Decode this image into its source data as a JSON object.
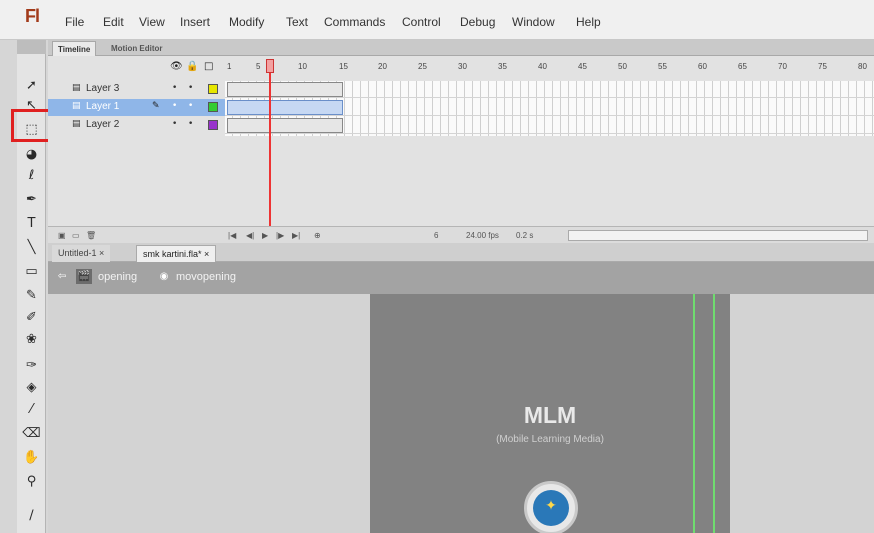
{
  "app": {
    "logo": "Fl"
  },
  "menu": [
    "File",
    "Edit",
    "View",
    "Insert",
    "Modify",
    "Text",
    "Commands",
    "Control",
    "Debug",
    "Window",
    "Help"
  ],
  "panel_tabs": {
    "timeline": "Timeline",
    "motion_editor": "Motion Editor"
  },
  "timeline": {
    "frame_numbers": [
      "1",
      "5",
      "10",
      "15",
      "20",
      "25",
      "30",
      "35",
      "40",
      "45",
      "50",
      "55",
      "60",
      "65",
      "70",
      "75",
      "80"
    ],
    "layers": [
      {
        "name": "Layer 3",
        "color": "#e6e600",
        "selected": false
      },
      {
        "name": "Layer 1",
        "color": "#33cc33",
        "selected": true
      },
      {
        "name": "Layer 2",
        "color": "#9933cc",
        "selected": false
      }
    ],
    "footer": {
      "frame": "6",
      "fps": "24.00 fps",
      "time": "0.2 s"
    }
  },
  "doc_tabs": [
    "Untitled-1",
    "smk kartini.fla*"
  ],
  "breadcrumb": {
    "scene": "opening",
    "symbol": "movopening"
  },
  "stage": {
    "title": "MLM",
    "subtitle": "(Mobile Learning Media)"
  },
  "colors": {
    "highlight": "#e02020",
    "stage_bg": "#828282",
    "guide": "#6fdc6f"
  }
}
